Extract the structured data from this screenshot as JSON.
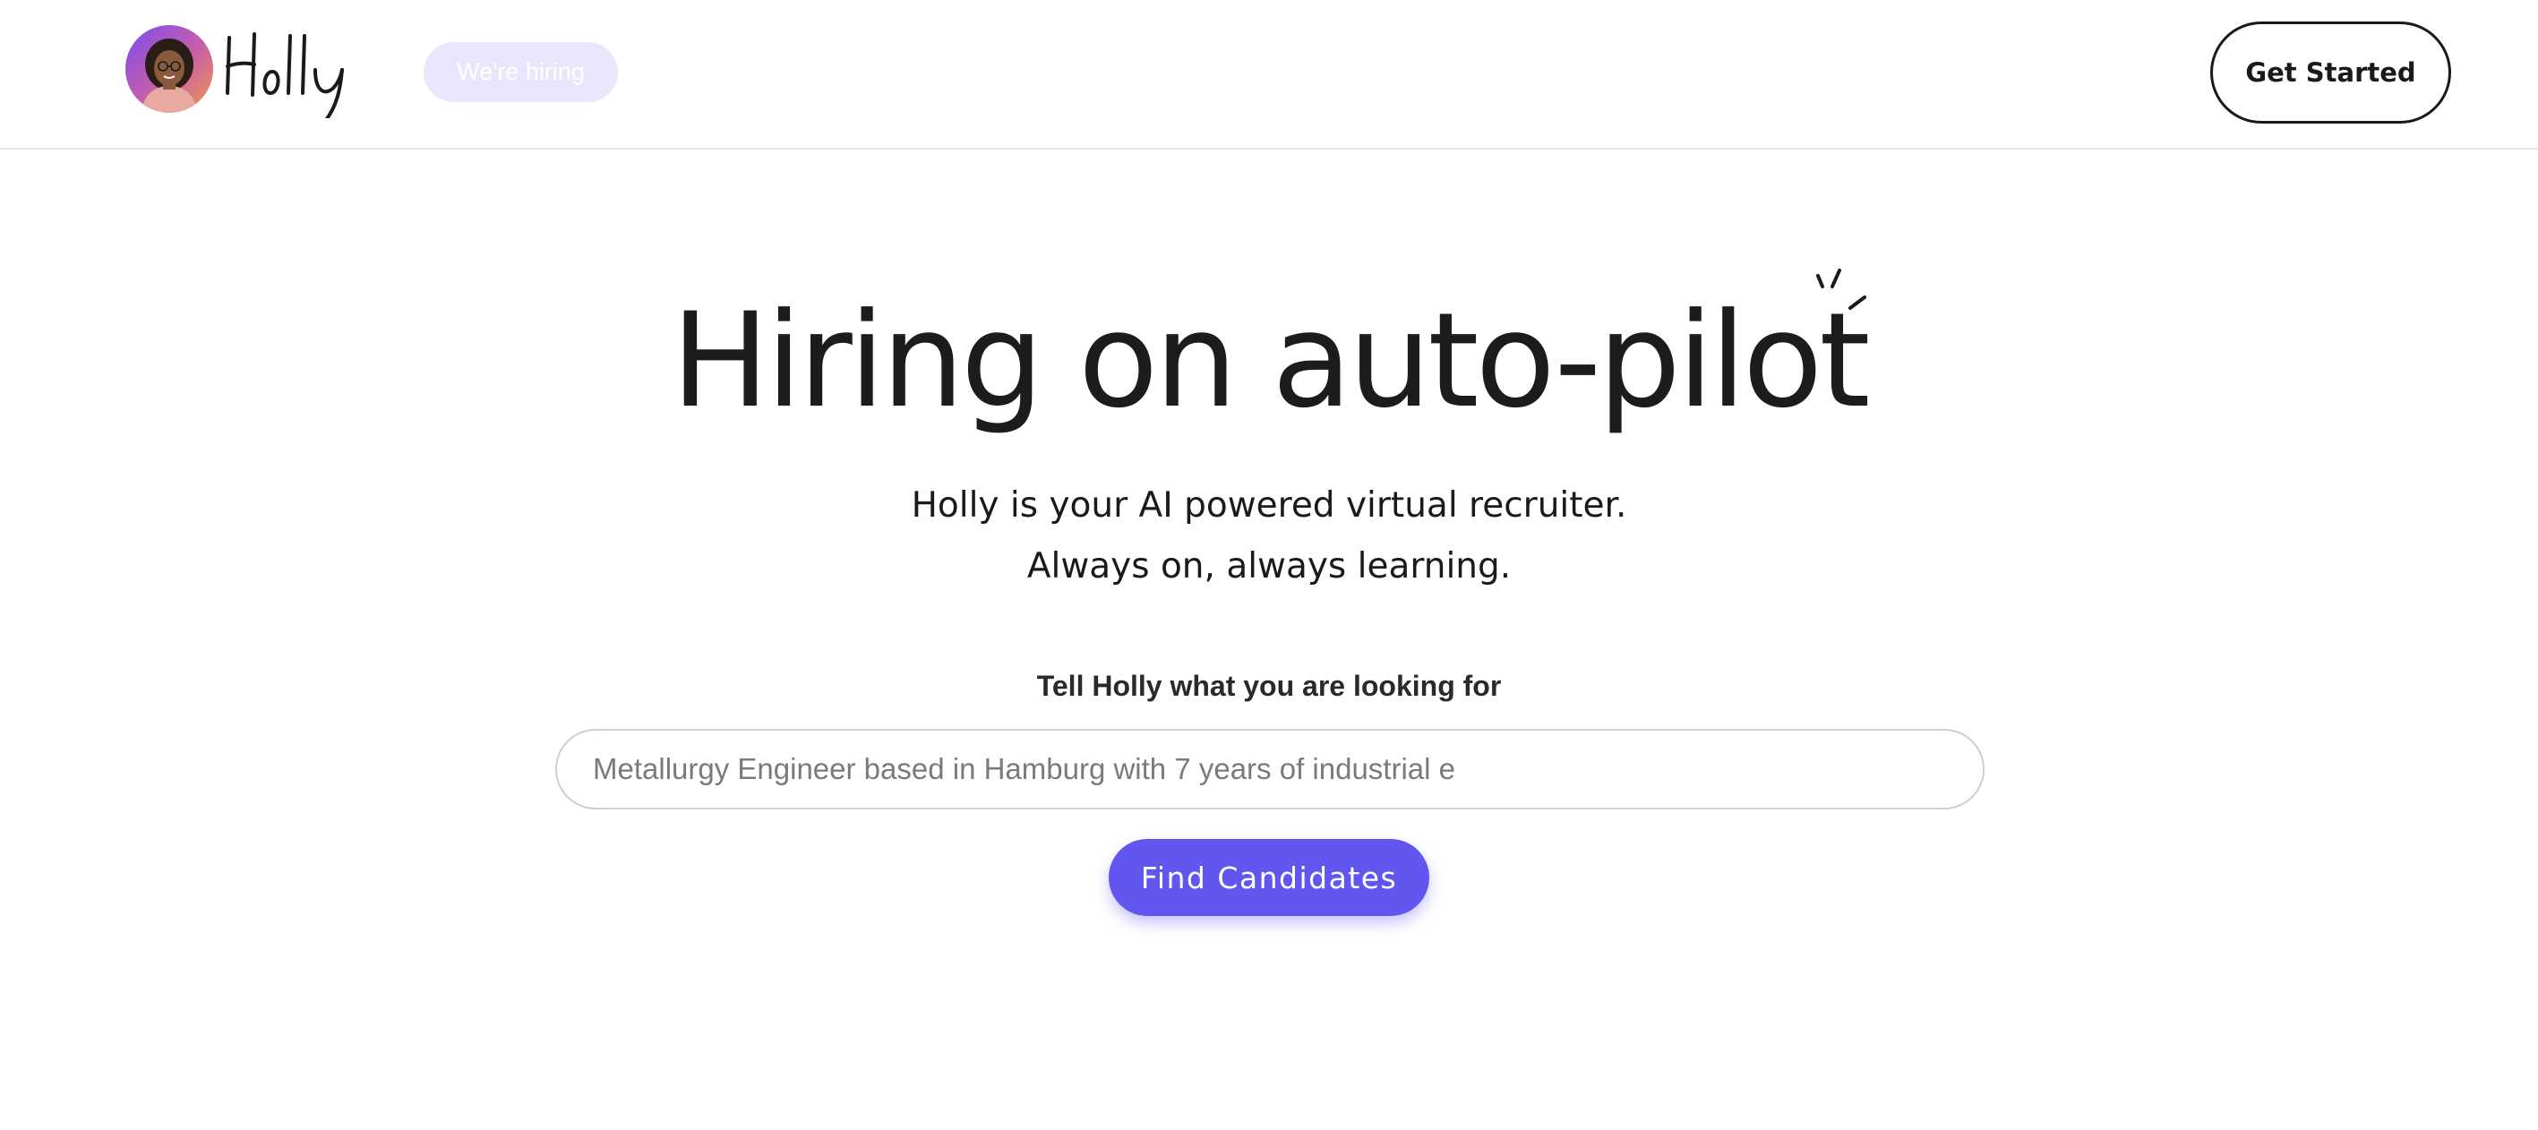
{
  "header": {
    "brand_name": "Holly",
    "hiring_badge": "We're hiring",
    "cta_label": "Get Started"
  },
  "hero": {
    "title": "Hiring on auto-pilot",
    "subtitle_line1": "Holly is your AI powered virtual recruiter.",
    "subtitle_line2": "Always on, always learning."
  },
  "search": {
    "label": "Tell Holly what you are looking for",
    "placeholder": "Metallurgy Engineer based in Hamburg with 7 years of industrial e",
    "value": "",
    "submit_label": "Find Candidates"
  },
  "colors": {
    "accent": "#6256f1",
    "badge_bg": "#e9e7fd",
    "text": "#1a1a1a"
  }
}
